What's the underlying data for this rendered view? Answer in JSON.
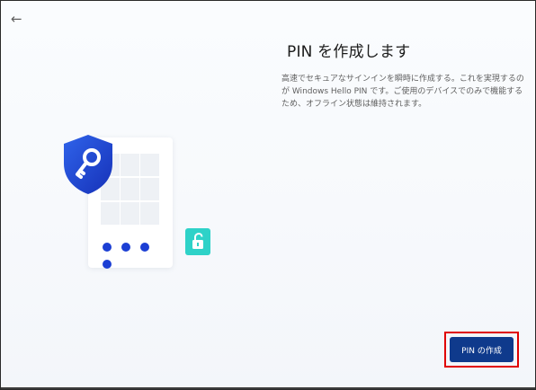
{
  "header": {
    "back_icon": "←"
  },
  "page": {
    "title": "PIN を作成します",
    "description": "高速でセキュアなサインインを瞬時に作成する。これを実現するのが Windows Hello PIN です。ご使用のデバイスでのみで機能するため、オフライン状態は維持されます。"
  },
  "illustration": {
    "pin_dot_count": 4,
    "icons": [
      "shield-key-icon",
      "unlock-icon"
    ],
    "colors": {
      "shield": "#1c3fd4",
      "dots": "#1c3fd4",
      "lock_badge": "#2ed2c8"
    }
  },
  "actions": {
    "primary_label": "PIN の作成"
  },
  "colors": {
    "primary_button": "#0f3a8c",
    "highlight_border": "#e00000"
  }
}
